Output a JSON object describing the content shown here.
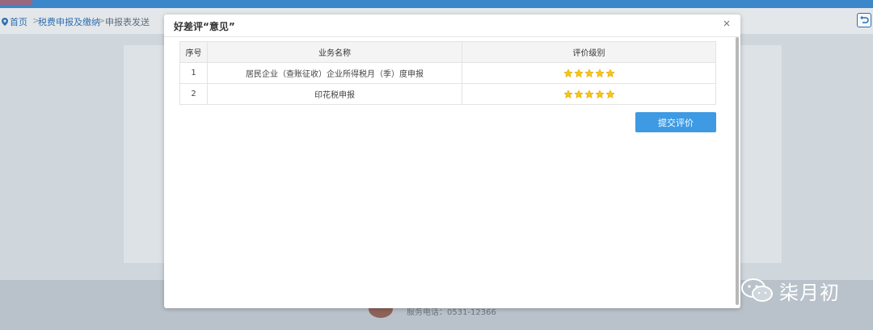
{
  "breadcrumb": {
    "home": "首页",
    "section": "税费申报及缴纳",
    "current": "申报表发送",
    "separator": ">"
  },
  "footer": {
    "phone": "服务电话：0531-12366"
  },
  "dialog": {
    "title": "好差评“意见”",
    "columns": {
      "index": "序号",
      "name": "业务名称",
      "rating": "评价级别"
    },
    "rows": [
      {
        "index": "1",
        "name": "居民企业（查账征收）企业所得税月（季）度申报",
        "rating": 5
      },
      {
        "index": "2",
        "name": "印花税申报",
        "rating": 5
      }
    ],
    "submit_label": "提交评价"
  },
  "watermark": {
    "text": "柒月初"
  },
  "colors": {
    "accent": "#3d9ae3",
    "star": "#f5c518",
    "header_bar": "#3a88c9"
  },
  "icons": [
    "location-pin-icon",
    "back-icon",
    "close-icon",
    "star-icon",
    "wechat-icon"
  ]
}
